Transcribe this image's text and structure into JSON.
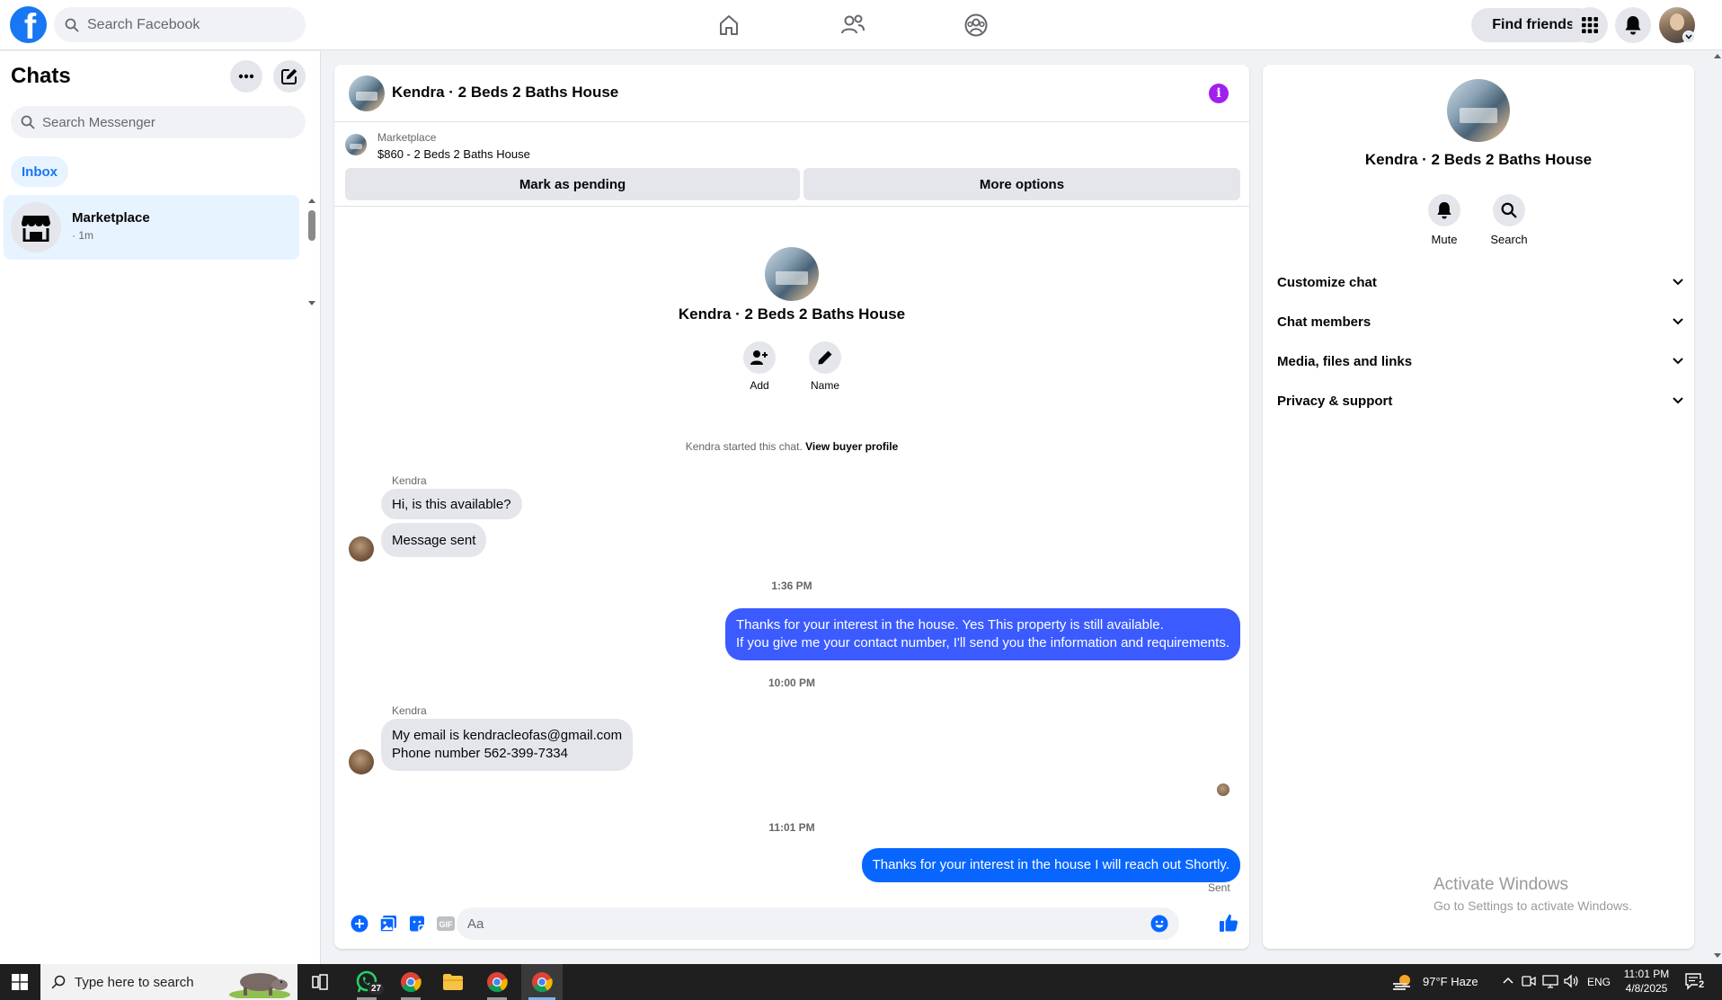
{
  "topbar": {
    "logo": "f",
    "search_placeholder": "Search Facebook",
    "find_friends_label": "Find friends",
    "icons": [
      "home-icon",
      "friends-icon",
      "groups-icon",
      "menu-grid-icon",
      "notifications-icon"
    ]
  },
  "sidebar": {
    "title": "Chats",
    "search_placeholder": "Search Messenger",
    "filter_label": "Inbox",
    "chats": [
      {
        "name": "Marketplace",
        "time": "· 1m"
      }
    ]
  },
  "conversation": {
    "title": "Kendra · 2 Beds 2 Baths House",
    "listing": {
      "label": "Marketplace",
      "title": "$860 - 2 Beds 2 Baths House"
    },
    "mark_pending_label": "Mark as pending",
    "more_options_label": "More options",
    "intro": {
      "name": "Kendra · 2 Beds 2 Baths House",
      "add_label": "Add",
      "name_label": "Name",
      "started_text": "Kendra started this chat.",
      "view_profile_link": "View buyer profile"
    },
    "messages": {
      "sender_1": "Kendra",
      "in_1": "Hi, is this available?",
      "in_2": "Message sent",
      "time_1": "1:36 PM",
      "out_1_line1": "Thanks for your interest in the house. Yes This property is still available.",
      "out_1_line2": "If you give me your contact number, I'll send you the information and requirements.",
      "time_2": "10:00 PM",
      "sender_2": "Kendra",
      "in_3_line1": "My email is kendracleofas@gmail.com",
      "in_3_line2": "Phone number 562-399-7334",
      "time_3": "11:01 PM",
      "out_2": "Thanks for your interest in the house I will reach out Shortly.",
      "status": "Sent"
    },
    "composer_placeholder": "Aa"
  },
  "info_panel": {
    "name": "Kendra · 2 Beds 2 Baths House",
    "mute_label": "Mute",
    "search_label": "Search",
    "sections": [
      "Customize chat",
      "Chat members",
      "Media, files and links",
      "Privacy & support"
    ]
  },
  "watermark": {
    "title": "Activate Windows",
    "subtitle": "Go to Settings to activate Windows."
  },
  "taskbar": {
    "search_placeholder": "Type here to search",
    "whatsapp_badge": "27",
    "weather": "97°F  Haze",
    "language": "ENG",
    "time": "11:01 PM",
    "date": "4/8/2025",
    "notifications_count": "2"
  },
  "colors": {
    "facebook_blue": "#1877f2",
    "outgoing_bubble": "#3b5bff",
    "outgoing_bubble_latest": "#0866ff",
    "info_button": "#a020f0"
  }
}
